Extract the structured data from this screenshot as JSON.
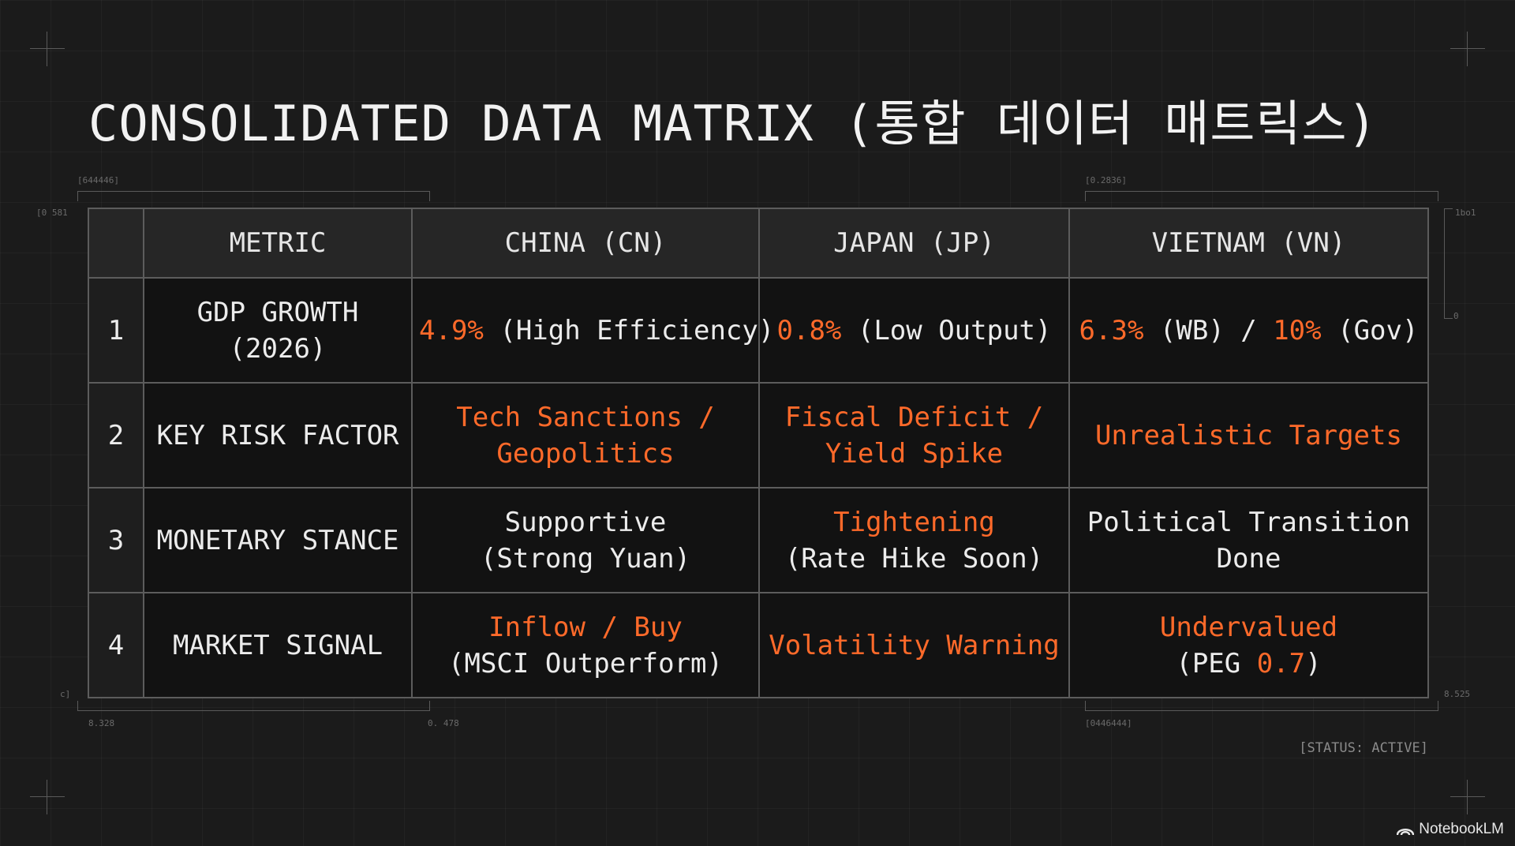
{
  "title": "CONSOLIDATED DATA MATRIX (통합 데이터 매트릭스)",
  "status": "[STATUS: ACTIVE]",
  "brand": "NotebookLM",
  "micro_labels": {
    "top_left": "[644446]",
    "top_right": "[0.2836]",
    "left_mid": "[0 581",
    "right_mid": "1bo1",
    "right_zero": "0",
    "left_low": "c]",
    "right_low": "8.525",
    "bottom_left": "8.328",
    "bottom_mid": "0. 478",
    "bottom_right": "[0446444]"
  },
  "colors": {
    "accent": "#ff6a2a",
    "text": "#ececec",
    "background": "#1b1b1b"
  },
  "table": {
    "headers": [
      "",
      "METRIC",
      "CHINA (CN)",
      "JAPAN (JP)",
      "VIETNAM (VN)"
    ],
    "rows": [
      {
        "num": "1",
        "metric": "GDP GROWTH (2026)",
        "cn": {
          "a": "4.9%",
          "b": " (High Efficiency)"
        },
        "jp": {
          "a": "0.8%",
          "b": " (Low Output)"
        },
        "vn": {
          "a": "6.3%",
          "b": " (WB) / ",
          "c": "10%",
          "d": " (Gov)"
        }
      },
      {
        "num": "2",
        "metric": "KEY RISK FACTOR",
        "cn": {
          "l1": "Tech Sanctions /",
          "l2": "Geopolitics"
        },
        "jp": {
          "l1": "Fiscal Deficit /",
          "l2": "Yield Spike"
        },
        "vn": {
          "l1": "Unrealistic Targets"
        }
      },
      {
        "num": "3",
        "metric": "MONETARY STANCE",
        "cn": {
          "l1": "Supportive",
          "l2": "(Strong Yuan)"
        },
        "jp": {
          "l1": "Tightening",
          "l2": "(Rate Hike Soon)"
        },
        "vn": {
          "l1": "Political Transition",
          "l2": "Done"
        }
      },
      {
        "num": "4",
        "metric": "MARKET SIGNAL",
        "cn": {
          "l1": "Inflow / Buy",
          "l2": "(MSCI Outperform)"
        },
        "jp": {
          "l1": "Volatility Warning"
        },
        "vn": {
          "l1": "Undervalued",
          "l2a": "(PEG ",
          "l2b": "0.7",
          "l2c": ")"
        }
      }
    ]
  }
}
